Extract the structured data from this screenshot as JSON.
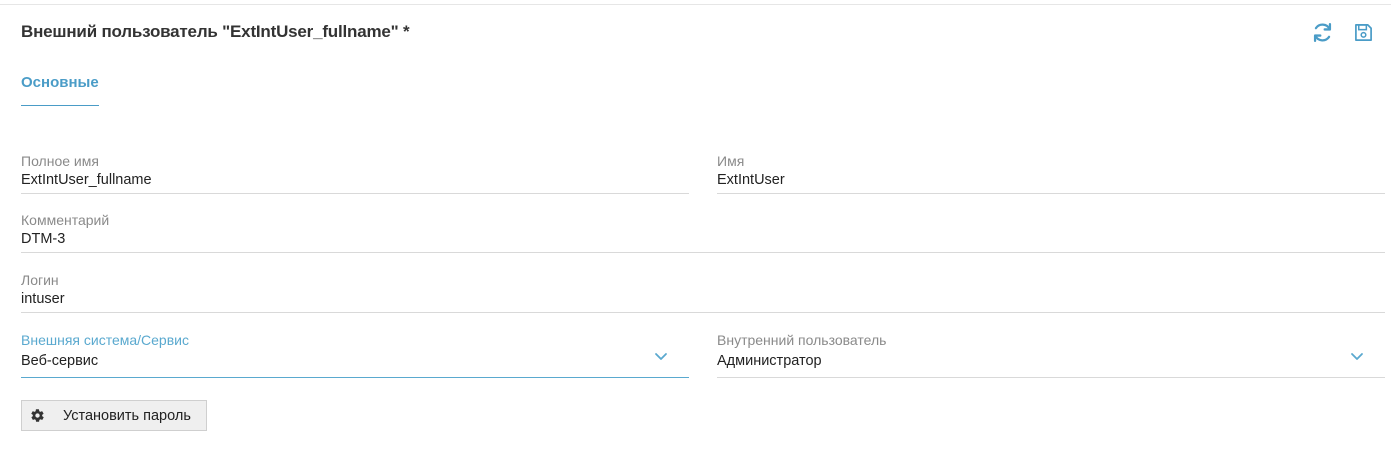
{
  "header": {
    "title": "Внешний пользователь \"ExtIntUser_fullname\" *",
    "refresh_icon": "refresh-icon",
    "save_icon": "save-icon"
  },
  "tabs": [
    {
      "label": "Основные",
      "active": true
    }
  ],
  "form": {
    "full_name": {
      "label": "Полное имя",
      "value": "ExtIntUser_fullname"
    },
    "name": {
      "label": "Имя",
      "value": "ExtIntUser"
    },
    "comment": {
      "label": "Комментарий",
      "value": "DTM-3"
    },
    "login": {
      "label": "Логин",
      "value": "intuser"
    },
    "external_system": {
      "label": "Внешняя система/Сервис",
      "value": "Веб-сервис"
    },
    "internal_user": {
      "label": "Внутренний пользователь",
      "value": "Администратор"
    }
  },
  "actions": {
    "set_password_label": "Установить пароль",
    "set_password_icon": "gear-icon"
  },
  "colors": {
    "accent": "#4a9cc7",
    "text": "#222222",
    "label": "#8a8a8a",
    "border": "#d9d9d9"
  }
}
